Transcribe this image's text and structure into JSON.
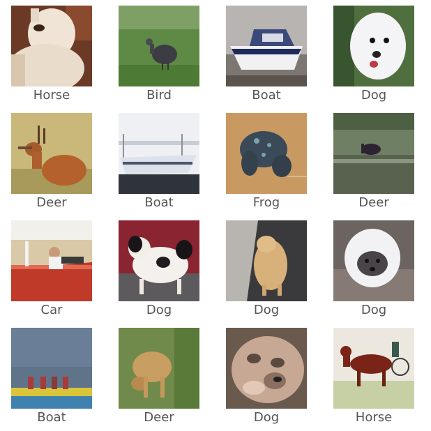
{
  "images": [
    {
      "label": "Horse",
      "subject": "horse-head"
    },
    {
      "label": "Bird",
      "subject": "bird"
    },
    {
      "label": "Boat",
      "subject": "boat-1"
    },
    {
      "label": "Dog",
      "subject": "dog-white"
    },
    {
      "label": "Deer",
      "subject": "deer-1"
    },
    {
      "label": "Boat",
      "subject": "boat-2"
    },
    {
      "label": "Frog",
      "subject": "frog"
    },
    {
      "label": "Deer",
      "subject": "deer-2"
    },
    {
      "label": "Car",
      "subject": "car"
    },
    {
      "label": "Dog",
      "subject": "dog-spotted"
    },
    {
      "label": "Dog",
      "subject": "dog-tan"
    },
    {
      "label": "Dog",
      "subject": "dog-fluffy"
    },
    {
      "label": "Boat",
      "subject": "boat-3"
    },
    {
      "label": "Deer",
      "subject": "deer-3"
    },
    {
      "label": "Dog",
      "subject": "dog-face"
    },
    {
      "label": "Horse",
      "subject": "horse-racing"
    }
  ]
}
